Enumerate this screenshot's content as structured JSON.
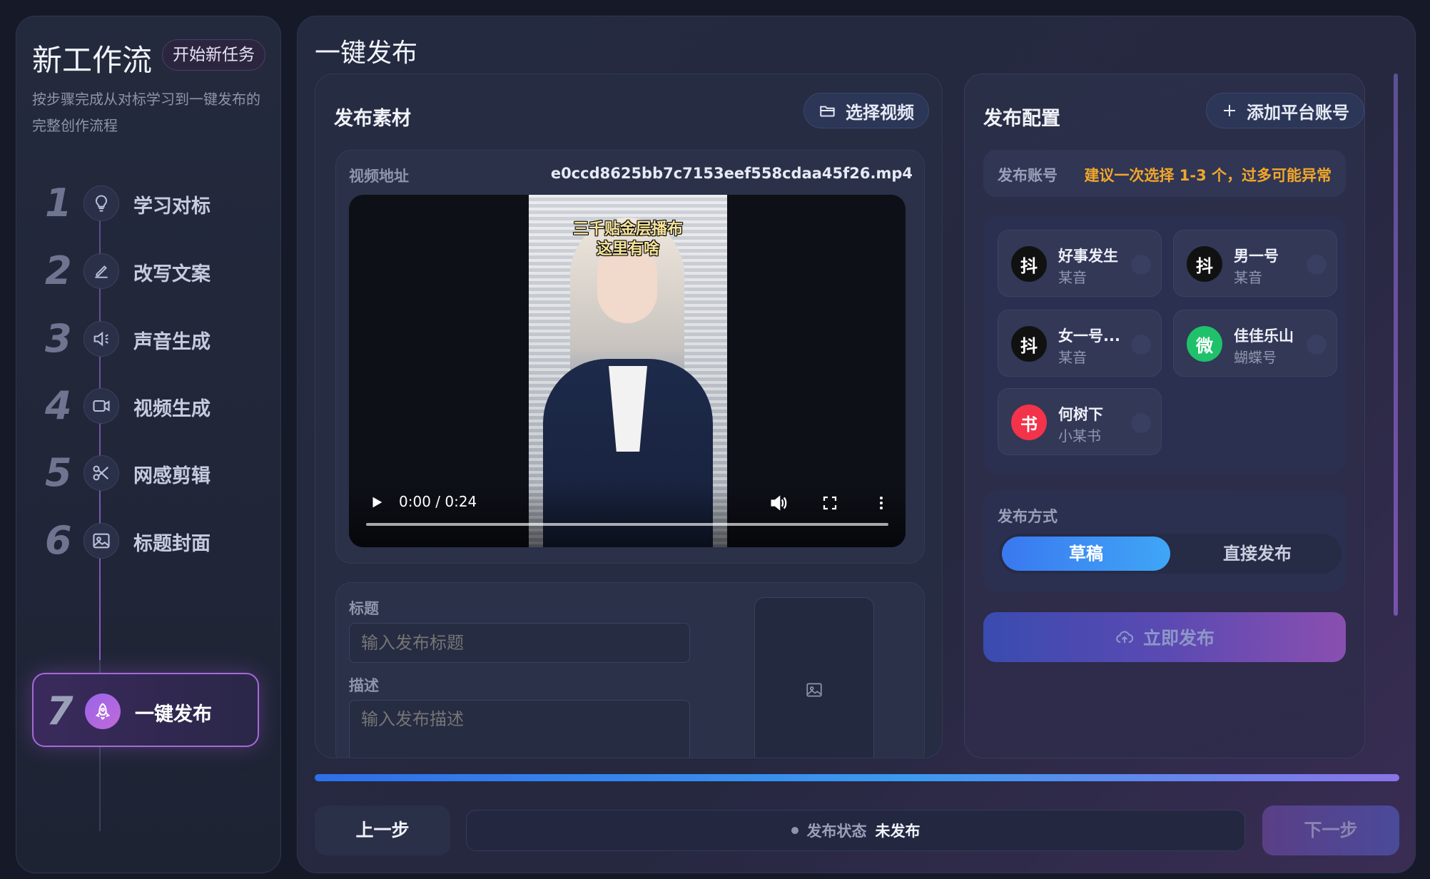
{
  "sidebar": {
    "title": "新工作流",
    "new_task": "开始新任务",
    "description": "按步骤完成从对标学习到一键发布的完整创作流程",
    "steps": [
      {
        "num": "1",
        "label": "学习对标",
        "icon": "lightbulb-icon"
      },
      {
        "num": "2",
        "label": "改写文案",
        "icon": "pen-icon"
      },
      {
        "num": "3",
        "label": "声音生成",
        "icon": "speaker-icon"
      },
      {
        "num": "4",
        "label": "视频生成",
        "icon": "video-camera-icon"
      },
      {
        "num": "5",
        "label": "网感剪辑",
        "icon": "scissors-icon"
      },
      {
        "num": "6",
        "label": "标题封面",
        "icon": "image-icon"
      },
      {
        "num": "7",
        "label": "一键发布",
        "icon": "rocket-icon"
      }
    ],
    "active_step": 7
  },
  "main": {
    "title": "一键发布",
    "material": {
      "heading": "发布素材",
      "select_video": "选择视频",
      "video_label": "视频地址",
      "video_file": "e0ccd8625bb7c7153eef558cdaa45f26.mp4",
      "caption_line1": "三千贴金层播布",
      "caption_line2": "这里有啥",
      "time": "0:00 / 0:24",
      "title_label": "标题",
      "title_placeholder": "输入发布标题",
      "desc_label": "描述",
      "desc_placeholder": "输入发布描述"
    },
    "config": {
      "heading": "发布配置",
      "add_account": "添加平台账号",
      "accounts_label": "发布账号",
      "accounts_warning": "建议一次选择 1-3 个，过多可能异常",
      "accounts": [
        {
          "logo": "抖",
          "name": "好事发生",
          "platform": "某音",
          "color": "#111111"
        },
        {
          "logo": "抖",
          "name": "男一号",
          "platform": "某音",
          "color": "#111111"
        },
        {
          "logo": "抖",
          "name": "女一号...",
          "platform": "某音",
          "color": "#111111"
        },
        {
          "logo": "微",
          "name": "佳佳乐山",
          "platform": "蝴蝶号",
          "color": "#1fc16b"
        },
        {
          "logo": "书",
          "name": "何树下",
          "platform": "小某书",
          "color": "#f2334a"
        }
      ],
      "mode_label": "发布方式",
      "mode_draft": "草稿",
      "mode_direct": "直接发布",
      "publish_now": "立即发布"
    }
  },
  "footer": {
    "prev": "上一步",
    "status_key": "发布状态",
    "status_value": "未发布",
    "next": "下一步"
  }
}
